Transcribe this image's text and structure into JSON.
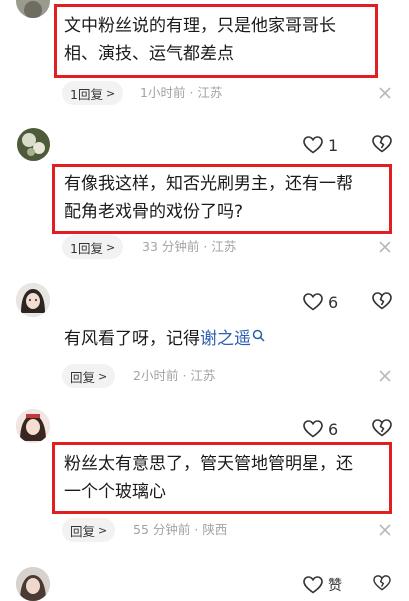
{
  "comments": [
    {
      "text_lines": [
        "文中粉丝说的有理，只是他家哥哥长",
        "相、演技、运气都差点"
      ],
      "reply_label": "1回复",
      "time": "1小时前",
      "location": "江苏"
    },
    {
      "likes": "1",
      "text_lines": [
        "有像我这样，知否光刷男主，还有一帮",
        "配角老戏骨的戏份了吗?"
      ],
      "reply_label": "1回复",
      "time": "33 分钟前",
      "location": "江苏"
    },
    {
      "likes": "6",
      "text_prefix": "有风看了呀，记得",
      "text_link": "谢之遥",
      "reply_label": "回复",
      "time": "2小时前",
      "location": "江苏"
    },
    {
      "likes": "6",
      "text_lines": [
        "粉丝太有意思了，管天管地管明星，还",
        "一个个玻璃心"
      ],
      "reply_label": "回复",
      "time": "55 分钟前",
      "location": "陕西"
    },
    {
      "likes": "赞"
    }
  ],
  "separator": "·",
  "colors": {
    "highlight": "#e02020",
    "meta": "#a3a3a3",
    "link": "#2b5fb0"
  },
  "icons": [
    "heart-icon",
    "broken-heart-icon",
    "close-icon",
    "search-icon",
    "chevron-right-icon"
  ]
}
